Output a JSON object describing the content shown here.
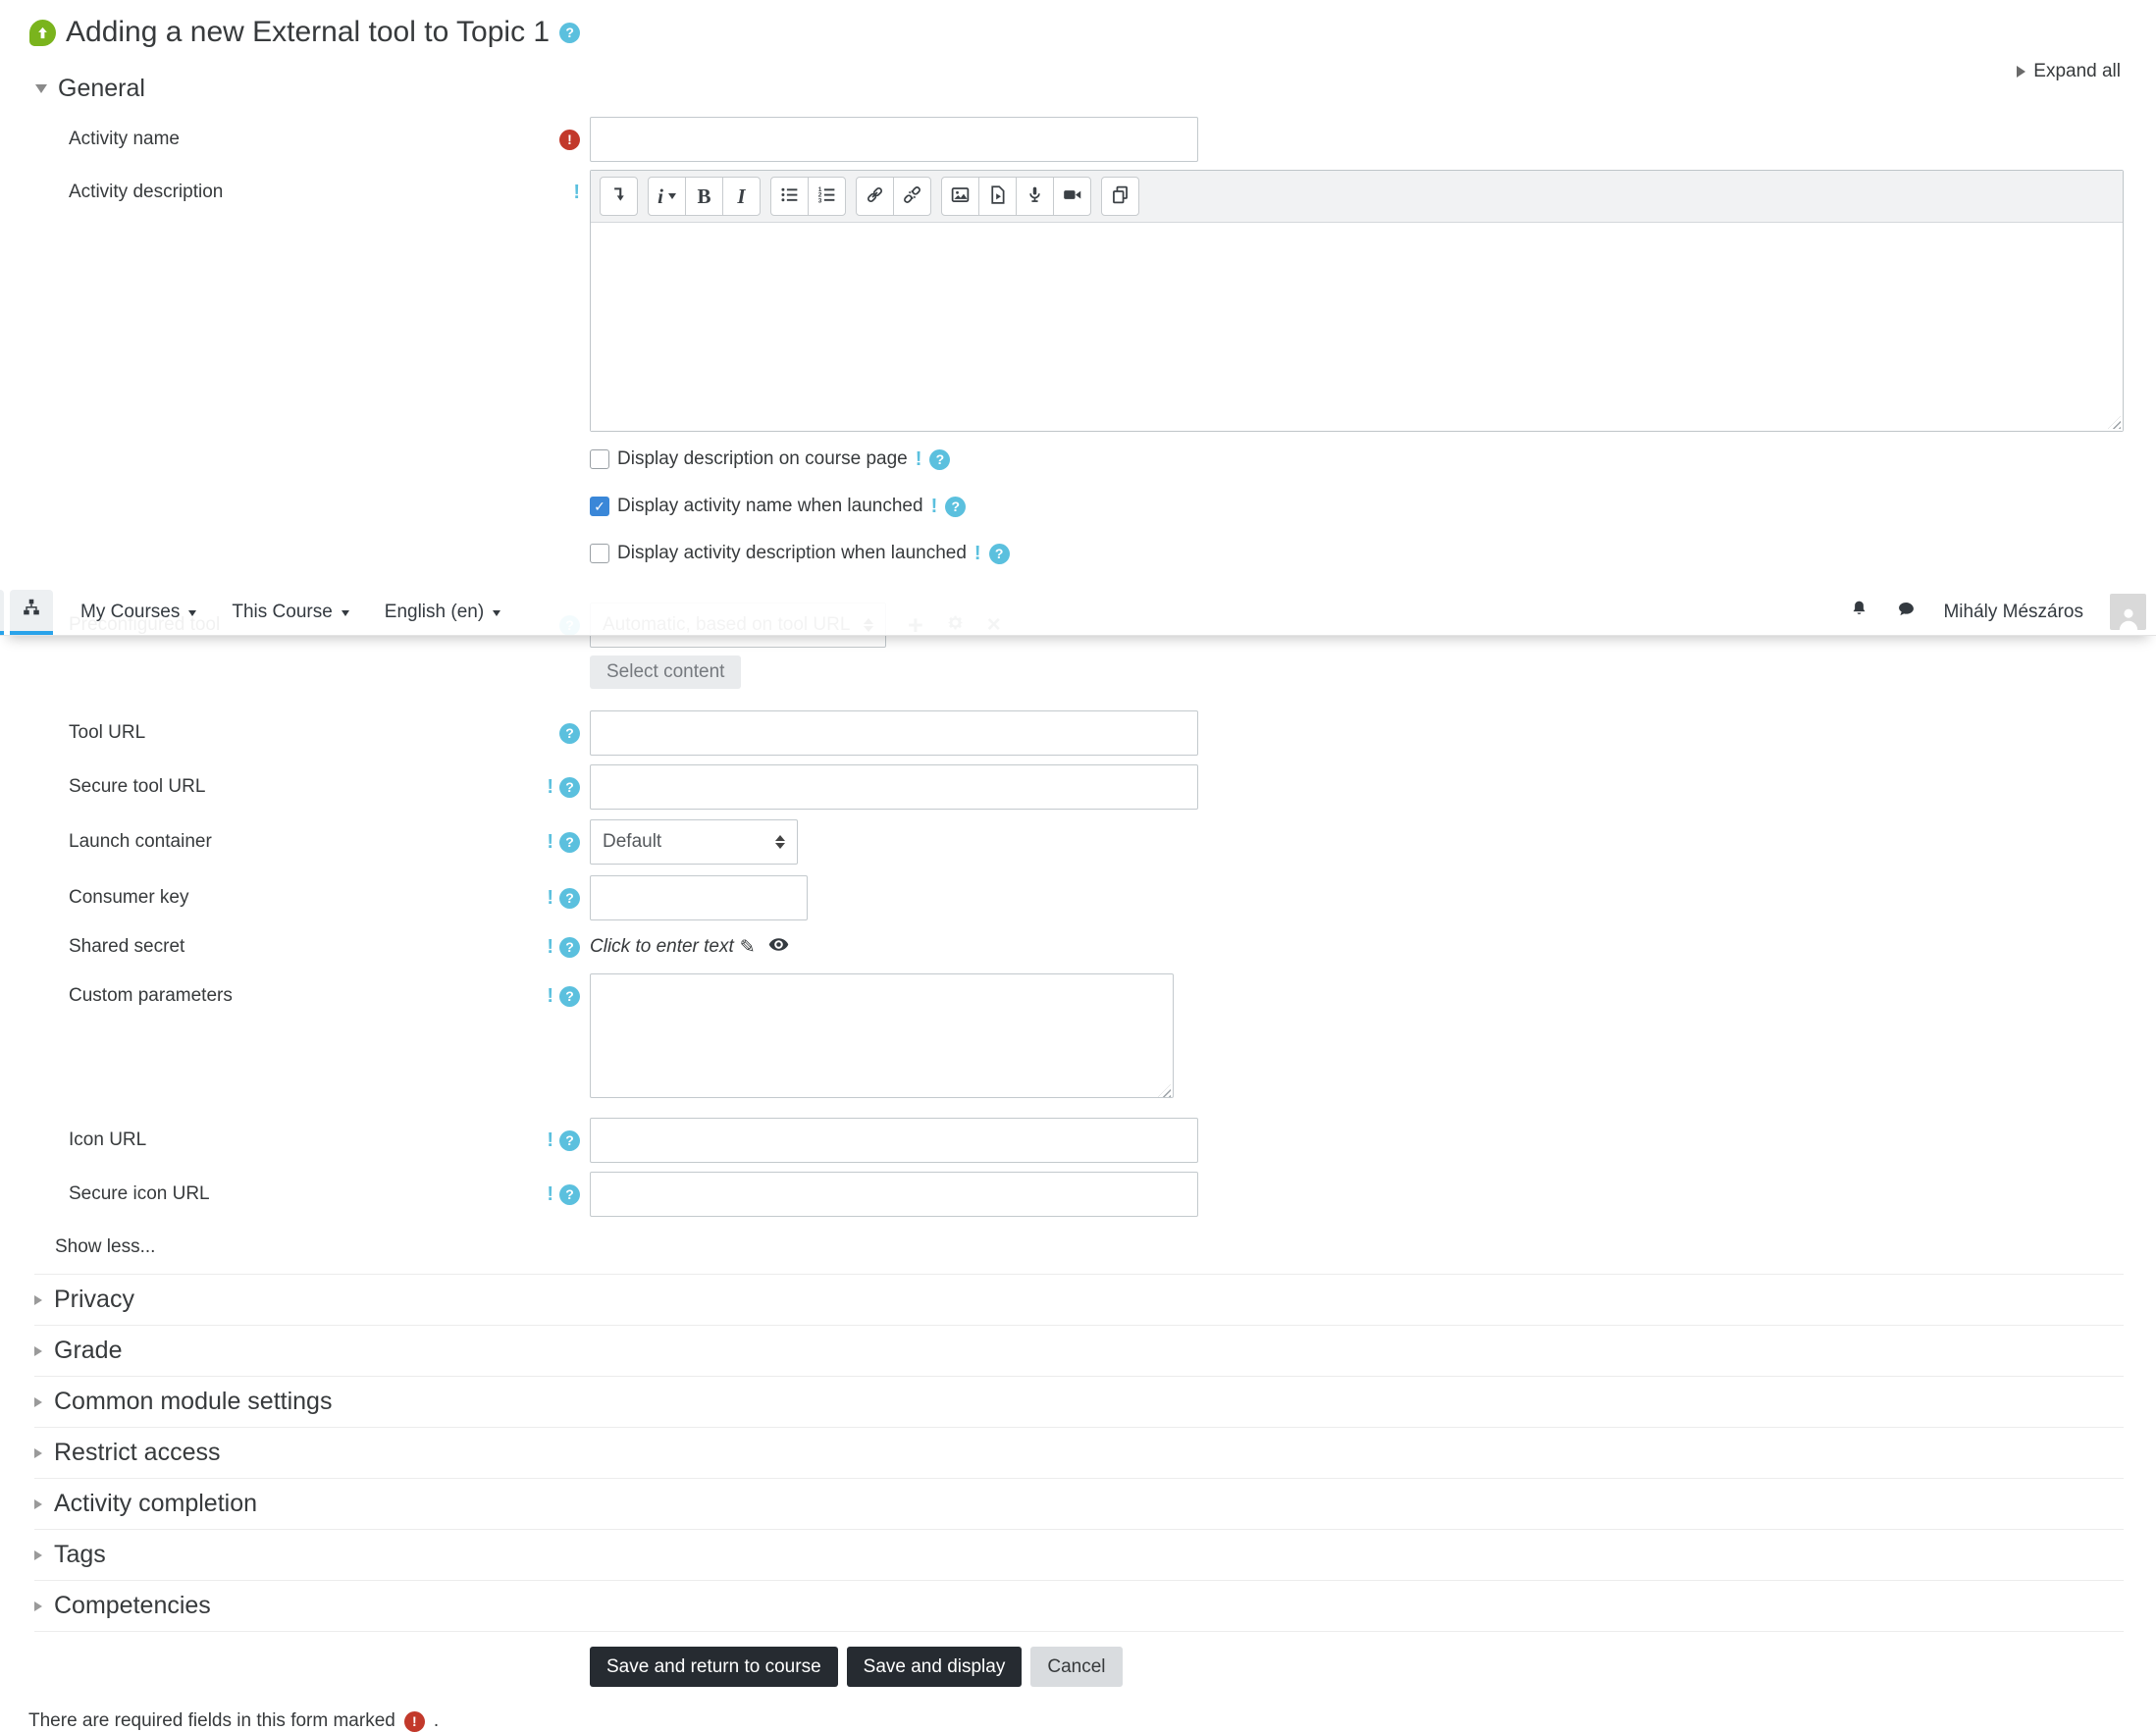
{
  "page": {
    "title": "Adding a new External tool to Topic 1",
    "expand_all": "Expand all",
    "required_note": "There are required fields in this form marked",
    "required_note_suffix": "."
  },
  "navbar": {
    "menu_items": [
      {
        "label": "My Courses"
      },
      {
        "label": "This Course"
      },
      {
        "label": "English (en)"
      }
    ],
    "user_name": "Mihály Mészáros",
    "icons": [
      "sitemap-icon",
      "bell-icon",
      "messages-icon",
      "avatar"
    ]
  },
  "general": {
    "heading": "General",
    "activity_name_label": "Activity name",
    "activity_description_label": "Activity description",
    "checkboxes": [
      {
        "label": "Display description on course page",
        "checked": false
      },
      {
        "label": "Display activity name when launched",
        "checked": true
      },
      {
        "label": "Display activity description when launched",
        "checked": false
      }
    ],
    "preconfigured_tool_label": "Preconfigured tool",
    "preconfigured_tool_value": "Automatic, based on tool URL",
    "select_content_label": "Select content",
    "tool_url_label": "Tool URL",
    "secure_tool_url_label": "Secure tool URL",
    "launch_container_label": "Launch container",
    "launch_container_value": "Default",
    "consumer_key_label": "Consumer key",
    "shared_secret_label": "Shared secret",
    "shared_secret_value": "Click to enter text",
    "custom_parameters_label": "Custom parameters",
    "icon_url_label": "Icon URL",
    "secure_icon_url_label": "Secure icon URL",
    "show_less": "Show less..."
  },
  "editor": {
    "toolbar_icons": [
      "toolbar-toggle",
      "paragraph-styles",
      "bold",
      "italic",
      "unordered-list",
      "ordered-list",
      "link",
      "unlink",
      "insert-image",
      "insert-media",
      "record-audio",
      "record-video",
      "manage-files"
    ],
    "glyphs": {
      "bold": "B",
      "italic": "I",
      "paragraph": "i"
    }
  },
  "sections": [
    {
      "title": "Privacy"
    },
    {
      "title": "Grade"
    },
    {
      "title": "Common module settings"
    },
    {
      "title": "Restrict access"
    },
    {
      "title": "Activity completion"
    },
    {
      "title": "Tags"
    },
    {
      "title": "Competencies"
    }
  ],
  "actions": {
    "save_return": "Save and return to course",
    "save_display": "Save and display",
    "cancel": "Cancel"
  },
  "colors": {
    "help_icon": "#5bc0de",
    "required_icon": "#c2392b",
    "checkbox_checked": "#3a87d8",
    "tab_underline": "#2aa3ea",
    "dark_button": "#262b31",
    "lti_icon": "#7ab41d"
  }
}
